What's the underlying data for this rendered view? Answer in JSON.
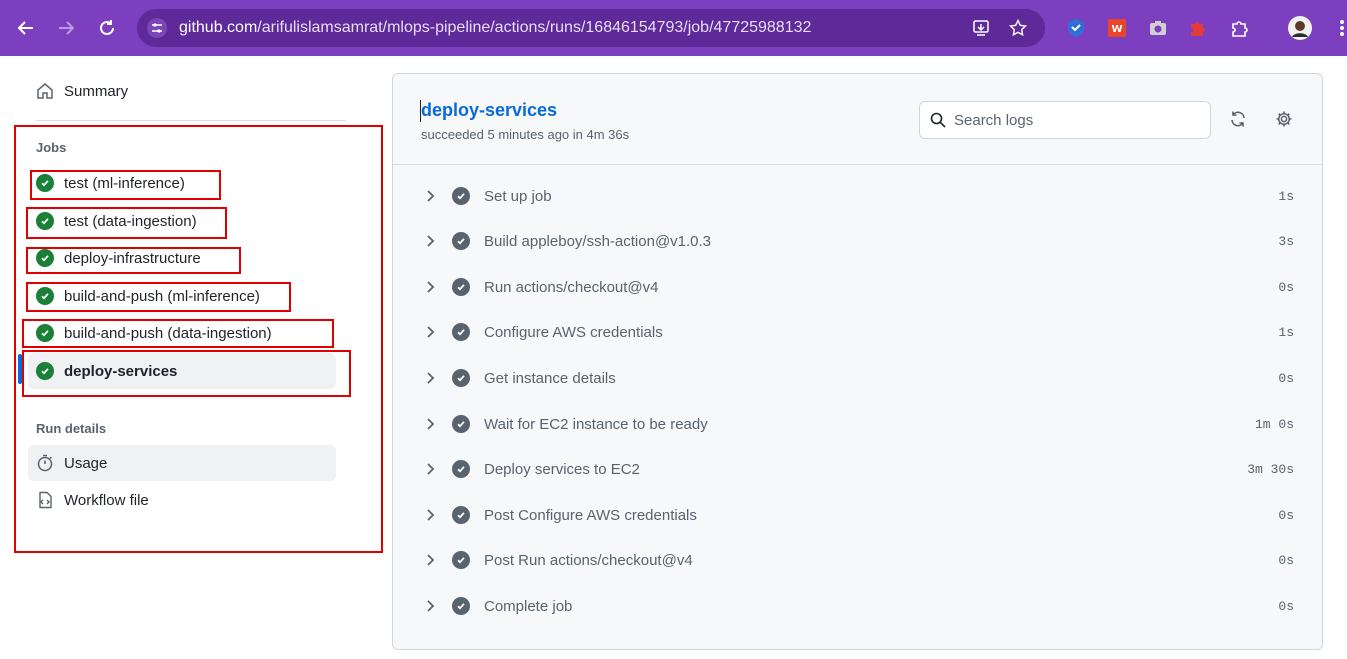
{
  "browser": {
    "url_host": "github.com",
    "url_path": "/arifulislamsamrat/mlops-pipeline/actions/runs/16846154793/job/47725988132"
  },
  "sidebar": {
    "summary_label": "Summary",
    "jobs_title": "Jobs",
    "jobs": [
      {
        "label": "test (ml-inference)"
      },
      {
        "label": "test (data-ingestion)"
      },
      {
        "label": "deploy-infrastructure"
      },
      {
        "label": "build-and-push (ml-inference)"
      },
      {
        "label": "build-and-push (data-ingestion)"
      },
      {
        "label": "deploy-services"
      }
    ],
    "run_details_title": "Run details",
    "usage_label": "Usage",
    "workflow_file_label": "Workflow file"
  },
  "main": {
    "job_title": "deploy-services",
    "job_subtitle": "succeeded 5 minutes ago in 4m 36s",
    "search_placeholder": "Search logs",
    "steps": [
      {
        "name": "Set up job",
        "duration": "1s"
      },
      {
        "name": "Build appleboy/ssh-action@v1.0.3",
        "duration": "3s"
      },
      {
        "name": "Run actions/checkout@v4",
        "duration": "0s"
      },
      {
        "name": "Configure AWS credentials",
        "duration": "1s"
      },
      {
        "name": "Get instance details",
        "duration": "0s"
      },
      {
        "name": "Wait for EC2 instance to be ready",
        "duration": "1m 0s"
      },
      {
        "name": "Deploy services to EC2",
        "duration": "3m 30s"
      },
      {
        "name": "Post Configure AWS credentials",
        "duration": "0s"
      },
      {
        "name": "Post Run actions/checkout@v4",
        "duration": "0s"
      },
      {
        "name": "Complete job",
        "duration": "0s"
      }
    ]
  },
  "colors": {
    "chrome": "#7b3fbf",
    "success": "#1a7f37",
    "link": "#0969da",
    "highlight_box": "#e00000"
  }
}
